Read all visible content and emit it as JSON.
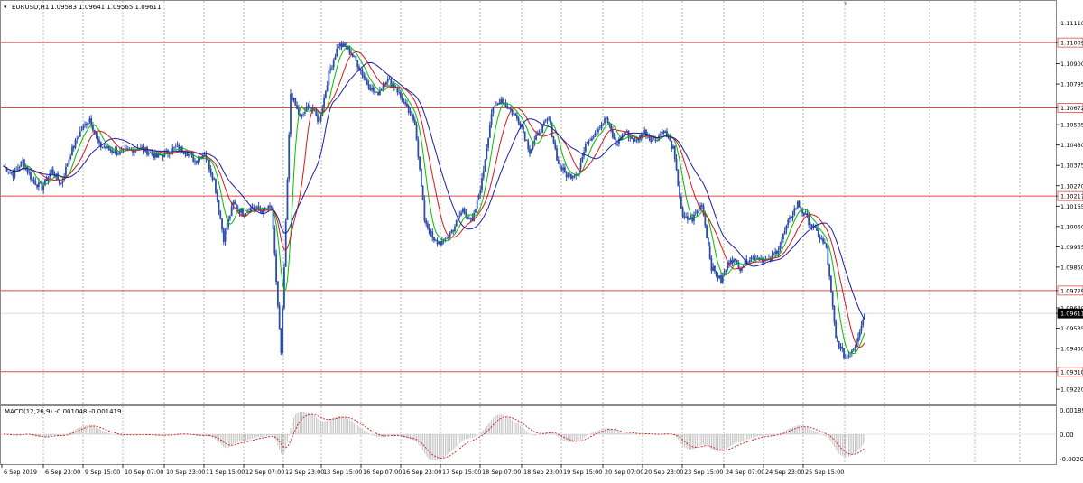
{
  "window": {
    "collapse_glyph": "▾",
    "symbol": "EURUSD,H1",
    "ohlc": "1.09583 1.09641 1.09565 1.09611"
  },
  "macd": {
    "label": "MACD(12,26,9) -0.001048 -0.001419",
    "scale": [
      "0.001895",
      "0.00",
      "-0.00206"
    ]
  },
  "price_scale": [
    "1.11110",
    "1.11009",
    "1.10900",
    "1.10795",
    "1.10672",
    "1.10585",
    "1.10480",
    "1.10375",
    "1.10270",
    "1.10217",
    "1.10165",
    "1.10060",
    "1.09955",
    "1.09850",
    "1.09729",
    "1.09640",
    "1.09611",
    "1.09535",
    "1.09430",
    "1.09310",
    "1.09220"
  ],
  "time_scale": [
    "6 Sep 2019",
    "6 Sep 23:00",
    "9 Sep 15:00",
    "10 Sep 07:00",
    "10 Sep 23:00",
    "11 Sep 15:00",
    "12 Sep 07:00",
    "12 Sep 23:00",
    "13 Sep 15:00",
    "16 Sep 07:00",
    "16 Sep 23:00",
    "17 Sep 15:00",
    "18 Sep 07:00",
    "18 Sep 23:00",
    "19 Sep 15:00",
    "20 Sep 07:00",
    "20 Sep 23:00",
    "23 Sep 15:00",
    "24 Sep 07:00",
    "24 Sep 23:00",
    "25 Sep 15:00"
  ],
  "levels": {
    "horizontal": [
      "1.11009",
      "1.10672",
      "1.10217",
      "1.09729",
      "1.09310"
    ],
    "current": "1.09611",
    "level_color": "#e04a4a",
    "current_color": "#000000"
  },
  "colors": {
    "candle": "#2c4da8",
    "ma_fast": "#00c000",
    "ma_mid": "#d01a1a",
    "ma_slow": "#1c1ca8",
    "grid": "#9a9a9a",
    "macd_hist": "#b8b8b8",
    "macd_signal": "#cc1a1a"
  },
  "chart_data": {
    "type": "candlestick",
    "symbol": "EURUSD",
    "timeframe": "H1",
    "ylim": [
      1.0916,
      1.1121
    ],
    "series": [
      {
        "name": "close",
        "values": [
          1.1037,
          1.1033,
          1.104,
          1.103,
          1.1026,
          1.1035,
          1.1028,
          1.1044,
          1.1055,
          1.1062,
          1.1048,
          1.1046,
          1.1044,
          1.1045,
          1.1047,
          1.1045,
          1.1042,
          1.1044,
          1.1047,
          1.1045,
          1.104,
          1.1044,
          1.103,
          1.1,
          1.1018,
          1.1013,
          1.1016,
          1.1014,
          1.1016,
          1.094,
          1.1075,
          1.1062,
          1.1069,
          1.106,
          1.1085,
          1.11,
          1.1098,
          1.109,
          1.108,
          1.1074,
          1.1082,
          1.1078,
          1.1068,
          1.106,
          1.101,
          1.0998,
          1.0998,
          1.1005,
          1.1015,
          1.1008,
          1.103,
          1.1065,
          1.1072,
          1.1066,
          1.106,
          1.1045,
          1.1055,
          1.1062,
          1.1038,
          1.1032,
          1.1034,
          1.105,
          1.1056,
          1.1062,
          1.1048,
          1.1055,
          1.105,
          1.1055,
          1.105,
          1.1056,
          1.1046,
          1.101,
          1.101,
          1.1018,
          1.0985,
          1.0978,
          1.099,
          1.0985,
          1.099,
          1.099,
          1.0988,
          1.0995,
          1.1008,
          1.1018,
          1.101,
          1.1003,
          1.0995,
          1.0948,
          1.0938,
          1.0945,
          1.0961
        ]
      }
    ],
    "indicators": [
      "MA fast",
      "MA mid",
      "MA slow",
      "MACD(12,26,9)"
    ]
  }
}
